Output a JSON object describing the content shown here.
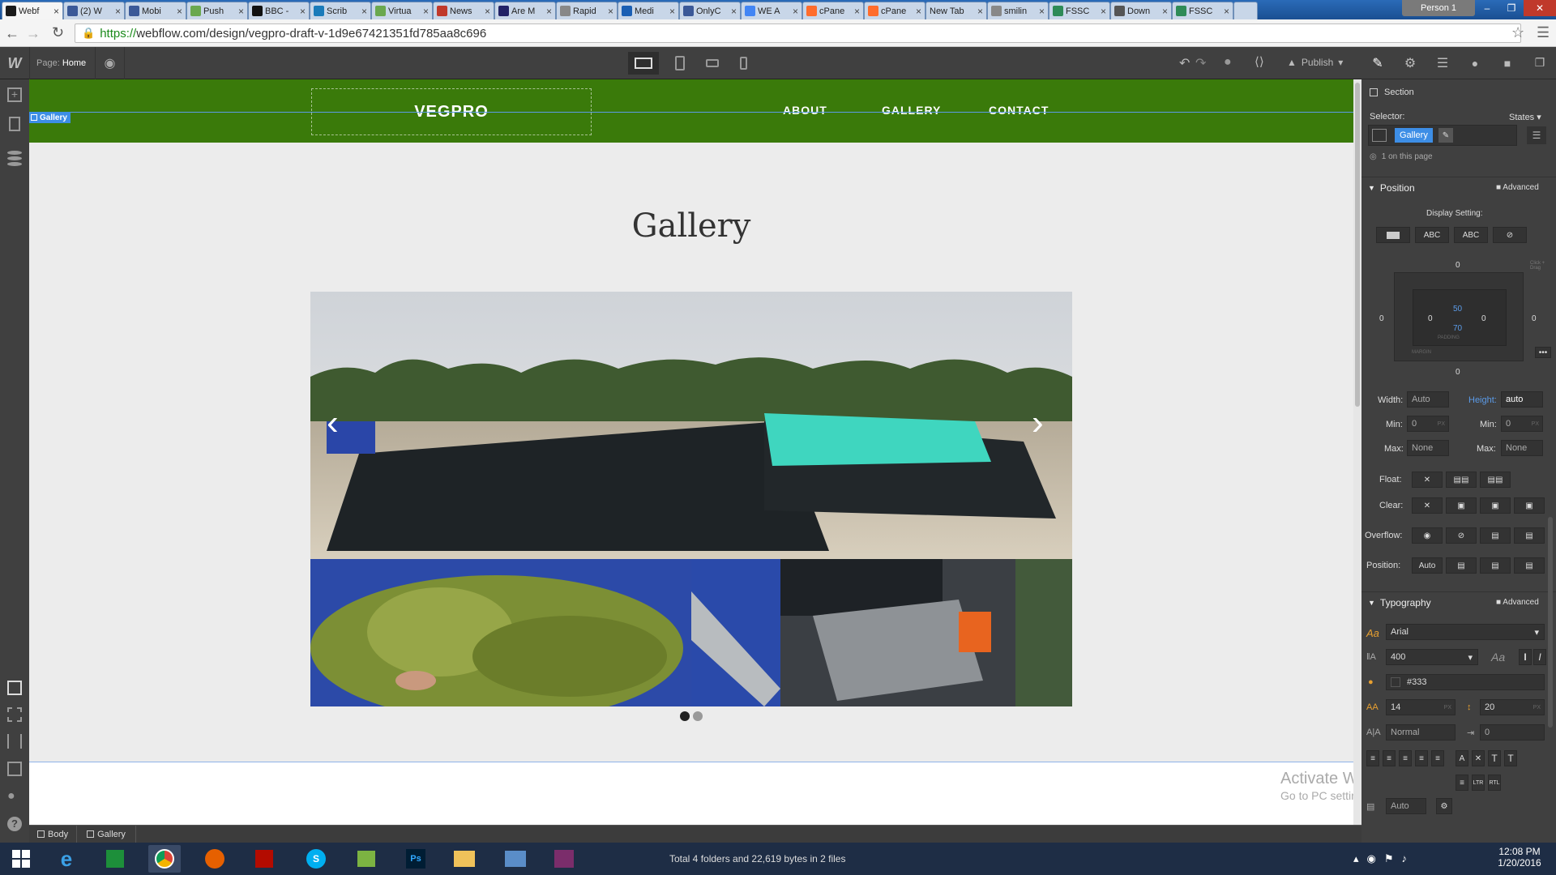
{
  "browser": {
    "tabs": [
      {
        "label": "Webf",
        "icon": "webflow-icon",
        "color": "#1a1a1a"
      },
      {
        "label": "(2) W",
        "icon": "quora-icon",
        "color": "#3b5998"
      },
      {
        "label": "Mobi",
        "icon": "quora-icon",
        "color": "#3b5998"
      },
      {
        "label": "Push",
        "icon": "page-icon",
        "color": "#6aa84f"
      },
      {
        "label": "BBC -",
        "icon": "bbc-icon",
        "color": "#111111"
      },
      {
        "label": "Scrib",
        "icon": "scribd-icon",
        "color": "#1a7bba"
      },
      {
        "label": "Virtua",
        "icon": "image-icon",
        "color": "#6aa84f"
      },
      {
        "label": "News",
        "icon": "news-icon",
        "color": "#c0392b"
      },
      {
        "label": "Are M",
        "icon": "mit-icon",
        "color": "#222266"
      },
      {
        "label": "Rapid",
        "icon": "page-icon",
        "color": "#888888"
      },
      {
        "label": "Medi",
        "icon": "b-icon",
        "color": "#1a5fb4"
      },
      {
        "label": "OnlyC",
        "icon": "facebook-icon",
        "color": "#3b5998"
      },
      {
        "label": "WE A",
        "icon": "google-icon",
        "color": "#4285f4"
      },
      {
        "label": "cPane",
        "icon": "cpanel-icon",
        "color": "#ff6c2c"
      },
      {
        "label": "cPane",
        "icon": "cpanel-icon",
        "color": "#ff6c2c"
      },
      {
        "label": "New Tab",
        "icon": "",
        "color": ""
      },
      {
        "label": "smilin",
        "icon": "page-icon",
        "color": "#888888"
      },
      {
        "label": "FSSC",
        "icon": "v-icon",
        "color": "#2e8b57"
      },
      {
        "label": "Down",
        "icon": "download-icon",
        "color": "#555555"
      },
      {
        "label": "FSSC",
        "icon": "v-icon",
        "color": "#2e8b57"
      }
    ],
    "profile": "Person 1",
    "url_scheme": "https://",
    "url_rest": "webflow.com/design/vegpro-draft-v-1d9e67421351fd785aa8c696"
  },
  "designer": {
    "page_label": "Page:",
    "page_name": "Home",
    "publish": "Publish",
    "selected_tag": "Gallery"
  },
  "site": {
    "logo": "VEGPRO",
    "nav": [
      "ABOUT",
      "GALLERY",
      "CONTACT"
    ],
    "gallery_title": "Gallery",
    "slider_dots": 2,
    "active_dot": 0
  },
  "panel": {
    "section_label": "Section",
    "selector_label": "Selector:",
    "states_label": "States",
    "selector_chip": "Gallery",
    "on_page": "1 on this page",
    "position_title": "Position",
    "advanced": "Advanced",
    "display_setting": "Display Setting:",
    "display_opts": [
      "",
      "ABC",
      "ABC",
      ""
    ],
    "box": {
      "margin_top": "0",
      "margin_right": "0",
      "margin_bottom": "0",
      "margin_left": "0",
      "padding_top": "50",
      "padding_bottom": "70",
      "padding_left": "0",
      "padding_right": "0",
      "padding_label": "PADDING",
      "margin_label": "MARGIN",
      "click_drag": "Click + Drag"
    },
    "width_label": "Width:",
    "width_val": "Auto",
    "height_label": "Height:",
    "height_val": "auto",
    "min_label": "Min:",
    "min_w": "0",
    "min_h": "0",
    "max_label": "Max:",
    "max_w": "None",
    "max_h": "None",
    "px": "PX",
    "float_label": "Float:",
    "clear_label": "Clear:",
    "overflow_label": "Overflow:",
    "position_label": "Position:",
    "position_val": "Auto",
    "typography_title": "Typography",
    "font": "Arial",
    "weight": "400",
    "color": "#333",
    "font_size": "14",
    "line_height": "20",
    "letter_spacing": "Normal",
    "text_indent": "0",
    "columns_val": "Auto"
  },
  "watermark": {
    "line1": "Activate Windows",
    "line2": "Go to PC settings to activate Windows."
  },
  "breadcrumb": [
    "Body",
    "Gallery"
  ],
  "taskbar": {
    "status": "Total 4 folders and 22,619 bytes in 2 files",
    "time": "12:08 PM",
    "date": "1/20/2016"
  },
  "colors": {
    "nav_green": "#3a7a0a",
    "panel_bg": "#404040",
    "accent": "#3d8ee6"
  }
}
